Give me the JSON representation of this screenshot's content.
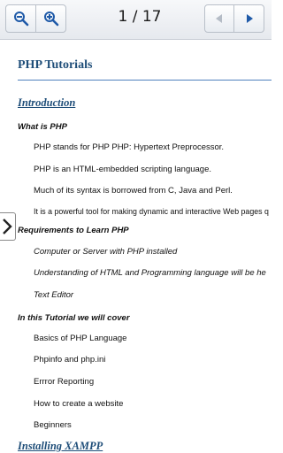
{
  "toolbar": {
    "zoom_out_icon": "zoom-out-icon",
    "zoom_in_icon": "zoom-in-icon",
    "page_indicator": "1 / 17",
    "prev_icon": "triangle-left-icon",
    "next_icon": "triangle-right-icon"
  },
  "document": {
    "title": "PHP Tutorials",
    "sections": [
      {
        "label": "Introduction"
      },
      {
        "label": "Installing XAMPP"
      }
    ],
    "blocks": [
      {
        "heading": "What is PHP",
        "lines": [
          "PHP stands for PHP PHP: Hypertext Preprocessor.",
          "PHP is an HTML-embedded scripting language.",
          "Much of its syntax is borrowed from C, Java and Perl.",
          "It is a powerful tool for making dynamic and interactive Web pages q"
        ]
      },
      {
        "heading": "Requirements to Learn PHP",
        "lines": [
          "Computer or Server with PHP installed",
          "Understanding of HTML and Programming language will be he",
          "Text Editor"
        ]
      },
      {
        "heading": "In this Tutorial we will cover",
        "lines": [
          "Basics of PHP Language",
          "Phpinfo and php.ini",
          "Errror Reporting",
          "How to create a website",
          "Beginners"
        ]
      }
    ]
  },
  "side_handle": {
    "icon": "chevron-right-icon"
  },
  "colors": {
    "title": "#1f4e79",
    "rule": "#4f81bd",
    "toolbar_icon": "#1f5aa8"
  }
}
